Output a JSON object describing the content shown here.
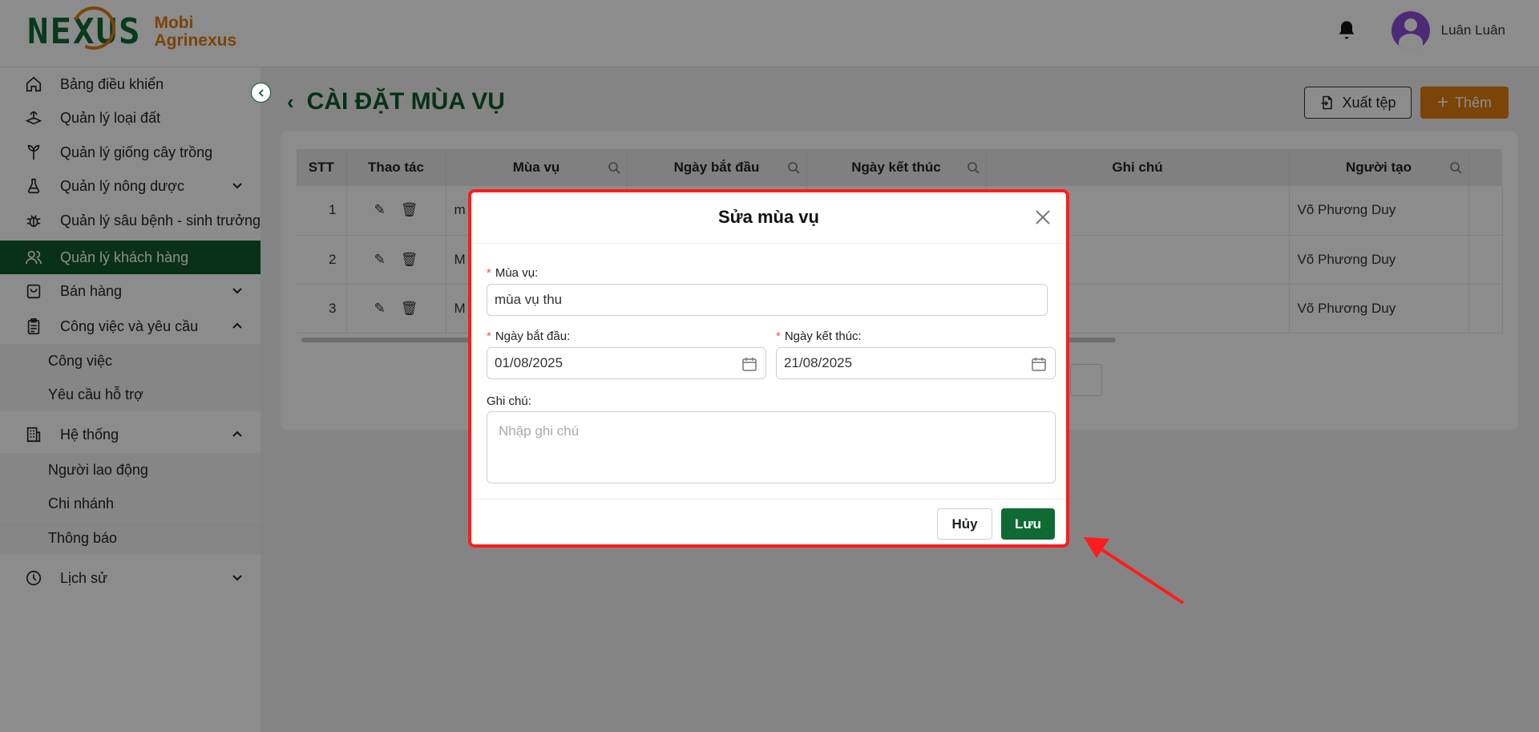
{
  "header": {
    "logo_mark": "NEXUS",
    "logo_line1": "Mobi",
    "logo_line2": "Agrinexus",
    "username": "Luân Luân"
  },
  "sidebar": {
    "items": [
      {
        "label": "Bảng điều khiển",
        "icon": "home-icon"
      },
      {
        "label": "Quản lý loại đất",
        "icon": "soil-icon"
      },
      {
        "label": "Quản lý giống cây trồng",
        "icon": "plant-icon"
      },
      {
        "label": "Quản lý nông dược",
        "icon": "flask-icon"
      },
      {
        "label": "Quản lý sâu bệnh - sinh trưởng",
        "icon": "bug-icon"
      },
      {
        "label": "Quản lý khách hàng",
        "icon": "users-icon"
      },
      {
        "label": "Bán hàng",
        "icon": "shopping-bag-icon"
      },
      {
        "label": "Công việc và yêu cầu",
        "icon": "clipboard-icon"
      },
      {
        "label": "Hệ thống",
        "icon": "building-icon"
      },
      {
        "label": "Lịch sử",
        "icon": "history-icon"
      }
    ],
    "sub_work": [
      "Công việc",
      "Yêu cầu hỗ trợ"
    ],
    "sub_system": [
      "Người lao động",
      "Chi nhánh",
      "Thông báo"
    ]
  },
  "main": {
    "title": "CÀI ĐẶT MÙA VỤ",
    "export_label": "Xuất tệp",
    "add_label": "Thêm",
    "columns": [
      "STT",
      "Thao tác",
      "Mùa vụ",
      "Ngày bắt đầu",
      "Ngày kết thúc",
      "Ghi chú",
      "Người tạo"
    ],
    "rows": [
      {
        "stt": "1",
        "season": "m",
        "creator": "Võ Phương Duy"
      },
      {
        "stt": "2",
        "season": "M",
        "creator": "Võ Phương Duy"
      },
      {
        "stt": "3",
        "season": "M",
        "creator": "Võ Phương Duy"
      }
    ]
  },
  "modal": {
    "title": "Sửa mùa vụ",
    "season_label": "Mùa vụ:",
    "season_value": "mùa vụ thu",
    "start_label": "Ngày bắt đầu:",
    "start_value": "01/08/2025",
    "end_label": "Ngày kết thúc:",
    "end_value": "21/08/2025",
    "note_label": "Ghi chú:",
    "note_placeholder": "Nhập ghi chú",
    "required_mark": "*",
    "cancel_label": "Hủy",
    "save_label": "Lưu"
  },
  "colors": {
    "brand_green": "#0f5a2a",
    "brand_orange": "#e07d12",
    "highlight_red": "#ff1c1c"
  }
}
